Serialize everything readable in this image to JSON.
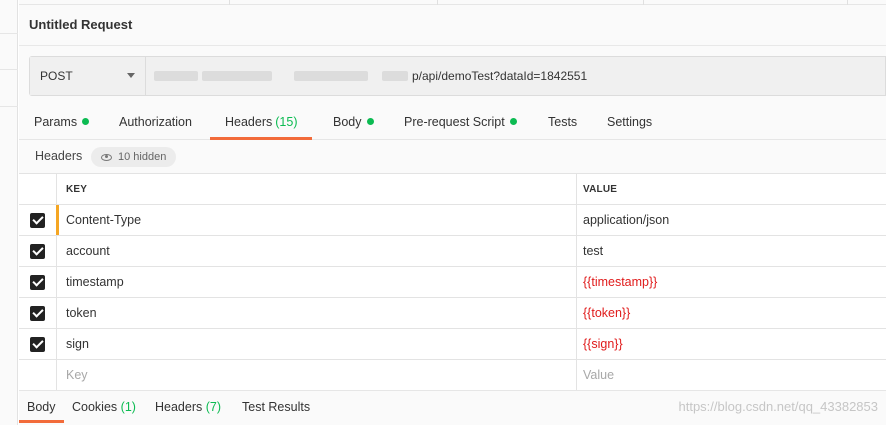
{
  "request": {
    "title": "Untitled Request",
    "method": "POST",
    "url_visible_part": "p/api/demoTest?dataId=1842551"
  },
  "request_tabs": [
    {
      "label": "Params",
      "dot": true
    },
    {
      "label": "Authorization",
      "dot": false
    },
    {
      "label": "Headers",
      "count": "(15)",
      "active": true
    },
    {
      "label": "Body",
      "dot": true
    },
    {
      "label": "Pre-request Script",
      "dot": true
    },
    {
      "label": "Tests",
      "dot": false
    },
    {
      "label": "Settings",
      "dot": false
    }
  ],
  "headers_section": {
    "label": "Headers",
    "hidden_label": "10 hidden"
  },
  "table": {
    "key_header": "KEY",
    "value_header": "VALUE",
    "rows": [
      {
        "key": "Content-Type",
        "value": "application/json",
        "checked": true,
        "variable": false
      },
      {
        "key": "account",
        "value": "test",
        "checked": true,
        "variable": false
      },
      {
        "key": "timestamp",
        "value": "{{timestamp}}",
        "checked": true,
        "variable": true
      },
      {
        "key": "token",
        "value": "{{token}}",
        "checked": true,
        "variable": true
      },
      {
        "key": "sign",
        "value": "{{sign}}",
        "checked": true,
        "variable": true
      }
    ],
    "key_placeholder": "Key",
    "value_placeholder": "Value"
  },
  "response_tabs": [
    {
      "label": "Body",
      "active": true
    },
    {
      "label": "Cookies",
      "count": "(1)"
    },
    {
      "label": "Headers",
      "count": "(7)"
    },
    {
      "label": "Test Results"
    }
  ],
  "watermark": "https://blog.csdn.net/qq_43382853",
  "colors": {
    "accent": "#f26b3a",
    "dot": "#0cbb52",
    "variable": "#e01b1b",
    "highlight": "#f5a623"
  }
}
